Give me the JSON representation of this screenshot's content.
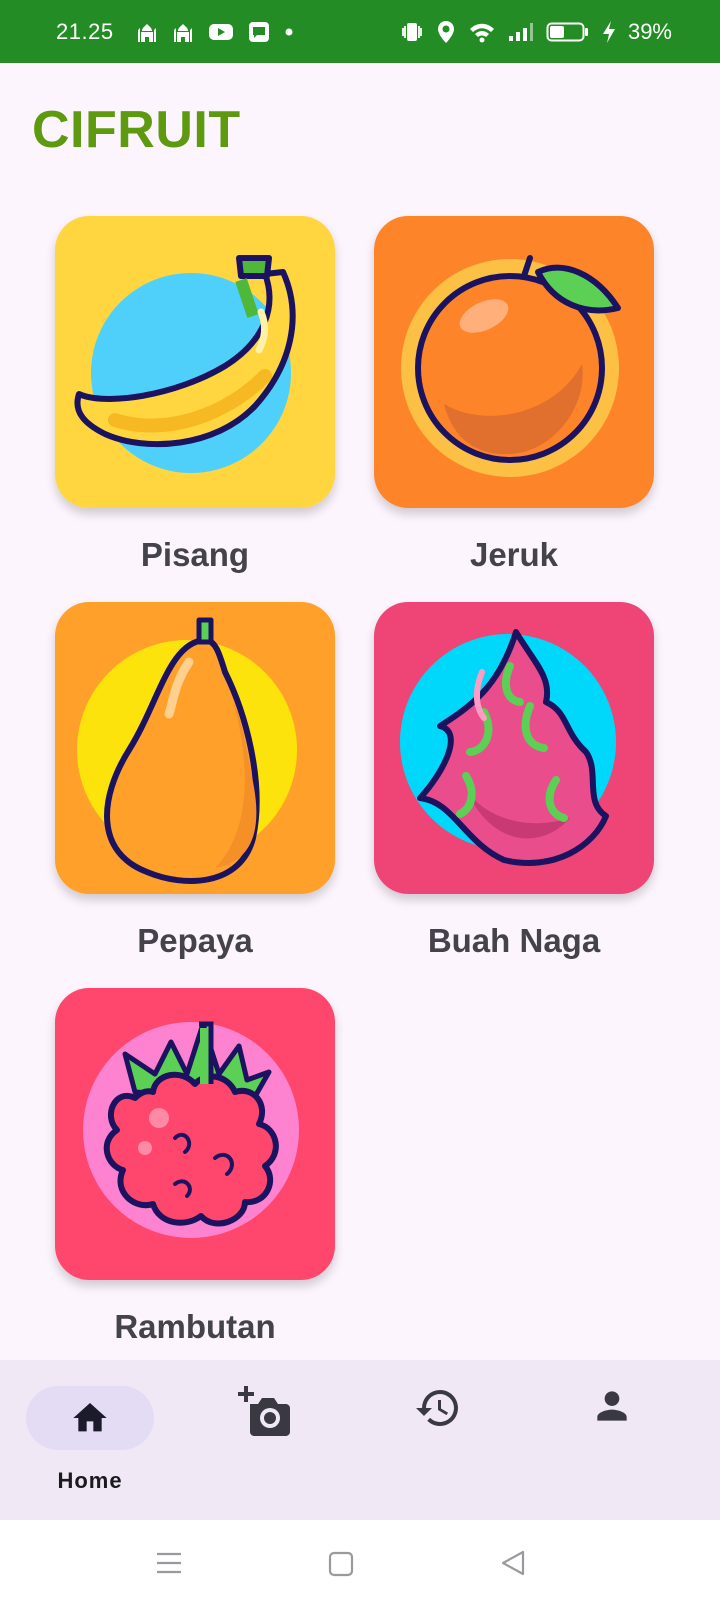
{
  "status_bar": {
    "time": "21.25",
    "battery_percent": "39%",
    "left_icons": [
      "mosque-icon",
      "mosque-icon",
      "youtube-icon",
      "message-icon",
      "dot-icon"
    ],
    "right_icons": [
      "vibrate-icon",
      "location-icon",
      "wifi-icon",
      "signal-icon",
      "battery-icon",
      "charging-icon"
    ]
  },
  "app": {
    "title": "CIFRUIT"
  },
  "fruits": [
    {
      "label": "Pisang",
      "bg": "#ffd640",
      "circle": "#4fd0fb"
    },
    {
      "label": "Jeruk",
      "bg": "#fe8429",
      "circle": "#fbc044"
    },
    {
      "label": "Pepaya",
      "bg": "#fea02a",
      "circle": "#fde30c"
    },
    {
      "label": "Buah Naga",
      "bg": "#ee4576",
      "circle": "#00d8fb"
    },
    {
      "label": "Rambutan",
      "bg": "#ff466d",
      "circle": "#fd82d0"
    }
  ],
  "bottom_nav": {
    "items": [
      {
        "label": "Home",
        "icon": "home-icon",
        "active": true
      },
      {
        "label": "",
        "icon": "add-photo-icon",
        "active": false
      },
      {
        "label": "",
        "icon": "history-icon",
        "active": false
      },
      {
        "label": "",
        "icon": "person-icon",
        "active": false
      }
    ]
  },
  "colors": {
    "status_bar": "#238c24",
    "title": "#5e9a10",
    "background": "#fdf5fd",
    "nav_bar": "#f0e8f5",
    "nav_active": "#e4dcf4"
  }
}
